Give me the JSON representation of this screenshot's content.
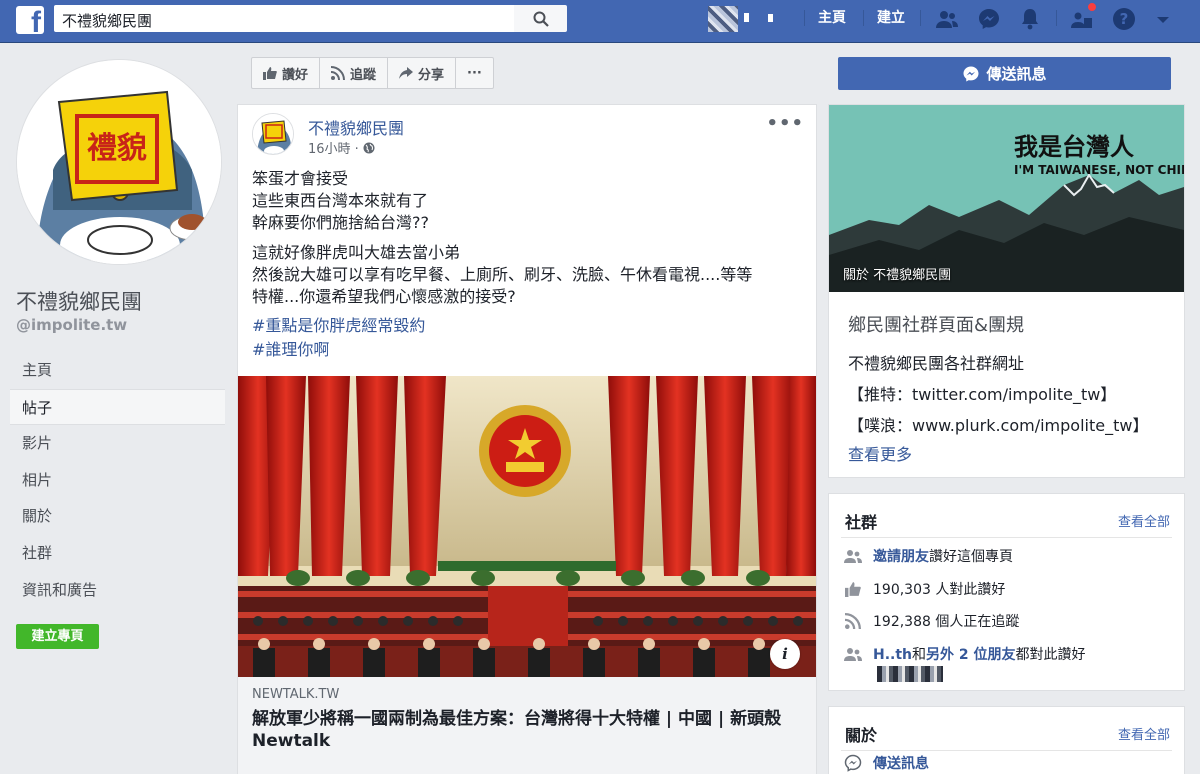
{
  "topbar": {
    "logo": "f",
    "search_value": "不禮貌鄉民團",
    "nav_home": "主頁",
    "nav_create": "建立",
    "icons": [
      "friends-icon",
      "messenger-icon",
      "bell-icon",
      "friend-requests-icon",
      "help-icon",
      "dropdown-icon"
    ],
    "brand_color": "#4267b2"
  },
  "page": {
    "name": "不禮貌鄉民團",
    "handle": "@impolite.tw",
    "nav": [
      "主頁",
      "帖子",
      "影片",
      "相片",
      "關於",
      "社群",
      "資訊和廣告"
    ],
    "active_nav": "帖子",
    "create_page_label": "建立專頁"
  },
  "actions": {
    "like": "讚好",
    "follow": "追蹤",
    "share": "分享",
    "more": "···",
    "send_message": "傳送訊息"
  },
  "post": {
    "author": "不禮貌鄉民團",
    "time": "16小時 ·",
    "more": "•••",
    "paragraph1": [
      "笨蛋才會接受",
      "這些東西台灣本來就有了",
      "幹麻要你們施捨給台灣??"
    ],
    "paragraph2": [
      "這就好像胖虎叫大雄去當小弟",
      "然後說大雄可以享有吃早餐、上廁所、刷牙、洗臉、午休看電視....等等",
      "特權...你還希望我們心懷感激的接受?"
    ],
    "hashtags": [
      "#重點是你胖虎經常毀約",
      "#誰理你啊"
    ],
    "link_domain": "NEWTALK.TW",
    "link_title": "解放軍少將稱一國兩制為最佳方案：台灣將得十大特權 | 中國 | 新頭殼 Newtalk",
    "info": "i"
  },
  "cover": {
    "title_zh": "我是台灣人",
    "title_en": "I'M TAIWANESE, NOT CHINESE",
    "caption": "關於 不禮貌鄉民團"
  },
  "about_box": {
    "title": "鄉民團社群頁面&團規",
    "lines": [
      "不禮貌鄉民團各社群網址",
      "【推特：twitter.com/impolite_tw】",
      "【噗浪：www.plurk.com/impolite_tw】"
    ],
    "see_more": "查看更多"
  },
  "community": {
    "title": "社群",
    "see_all": "查看全部",
    "invite_link": "邀請朋友",
    "invite_text": "讚好這個專頁",
    "likes": "190,303 人對此讚好",
    "follows": "192,388 個人正在追蹤",
    "friends_name": "H..th",
    "friends_and": "和",
    "friends_others": "另外 2 位朋友",
    "friends_suffix": "都對此讚好"
  },
  "about": {
    "title": "關於",
    "see_all": "查看全部",
    "send_message": "傳送訊息"
  }
}
